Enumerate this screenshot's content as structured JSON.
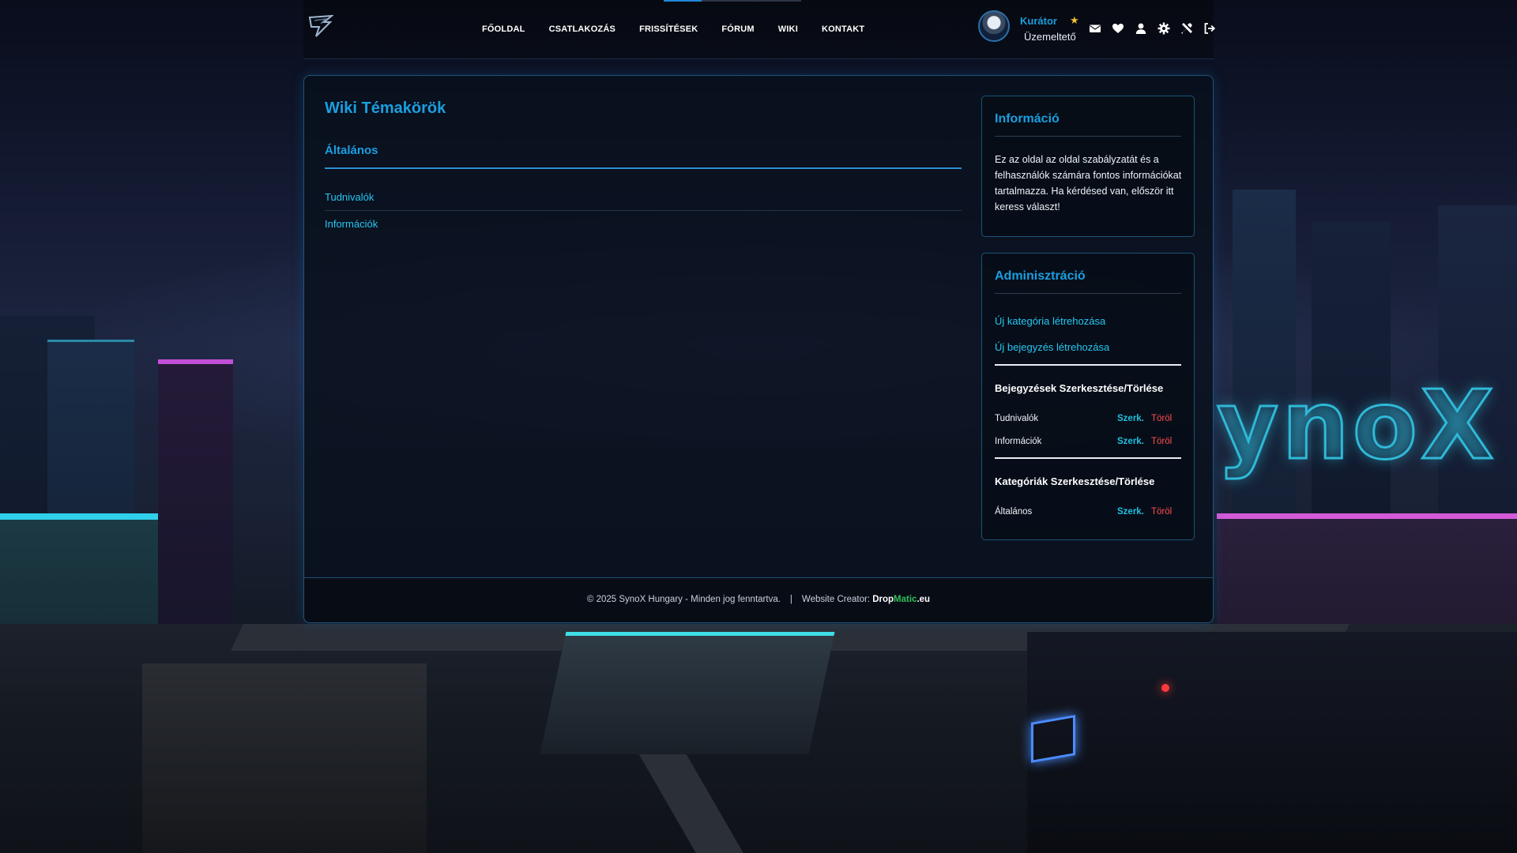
{
  "nav": {
    "items": [
      "FŐOLDAL",
      "CSATLAKOZÁS",
      "FRISSÍTÉSEK",
      "FÓRUM",
      "WIKI",
      "KONTAKT"
    ]
  },
  "user": {
    "name": "Kurátor",
    "role": "Üzemeltető"
  },
  "icons": [
    "mail-icon",
    "heart-icon",
    "user-icon",
    "gear-icon",
    "tools-icon",
    "logout-icon"
  ],
  "wiki": {
    "title": "Wiki Témakörök",
    "category": "Általános",
    "entries": [
      "Tudnivalók",
      "Információk"
    ]
  },
  "info_box": {
    "title": "Információ",
    "text": "Ez az oldal az oldal szabályzatát és a felhasználók számára fontos információkat tartalmazza. Ha kérdésed van, először itt keress választ!"
  },
  "admin_box": {
    "title": "Adminisztráció",
    "links": [
      "Új kategória létrehozása",
      "Új bejegyzés létrehozása"
    ],
    "entries_heading": "Bejegyzések Szerkesztése/Törlése",
    "entries": [
      {
        "name": "Tudnivalók",
        "edit": "Szerk.",
        "delete": "Töröl"
      },
      {
        "name": "Információk",
        "edit": "Szerk.",
        "delete": "Töröl"
      }
    ],
    "categories_heading": "Kategóriák Szerkesztése/Törlése",
    "categories": [
      {
        "name": "Általános",
        "edit": "Szerk.",
        "delete": "Töröl"
      }
    ]
  },
  "footer": {
    "copyright": "© 2025 SynoX Hungary - Minden jog fenntartva.",
    "separator": "|",
    "creator_label": "Website Creator:",
    "brand_part1": "Drop",
    "brand_part2": "Matic",
    "brand_part3": ".eu"
  },
  "colors": {
    "accent": "#1a9fe0",
    "link": "#25c6f0",
    "danger": "#ff4d4d",
    "star": "#f2c230"
  }
}
